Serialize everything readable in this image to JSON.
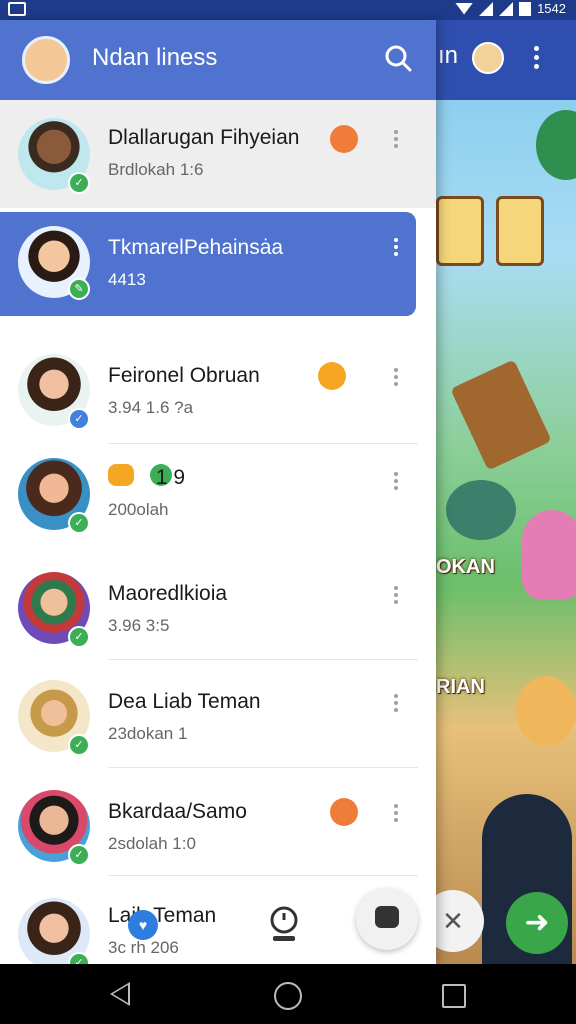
{
  "status_bar": {
    "time": "1542"
  },
  "header": {
    "title": "Ndan lineѕs"
  },
  "background": {
    "sign_1": "OKAN",
    "sign_2": "RIAN"
  },
  "friends": [
    {
      "name": "Dlallarugan Fihyeian",
      "meta": "Brdlokah  1:6",
      "status_color": "#f07c3a"
    },
    {
      "name": "TkmarelPehainsȧa",
      "meta": "4413",
      "selected": true
    },
    {
      "name": "Feironel Obruan",
      "meta": "3.94    1.6 ?a"
    },
    {
      "name": "   1  9",
      "meta": "200olah"
    },
    {
      "name": "Maoredlkioia",
      "meta": "3.96    3:5"
    },
    {
      "name": "Dea Liab Teman",
      "meta": "23dokan  1"
    },
    {
      "name": "Bkardaa/Samo",
      "meta": "2sdolah  1:0"
    },
    {
      "name": "Laih Teman",
      "meta": "3c      rh  206"
    }
  ]
}
